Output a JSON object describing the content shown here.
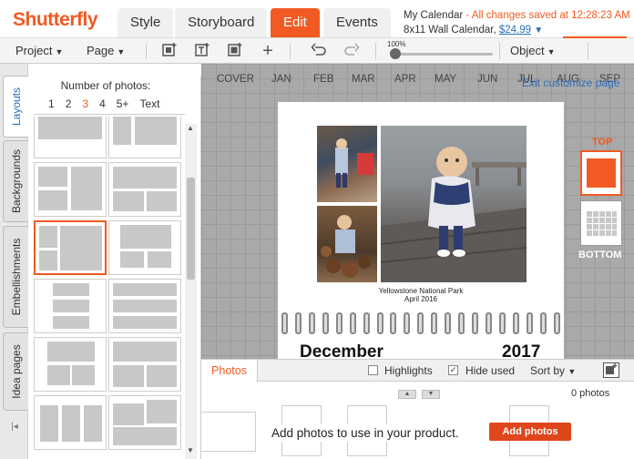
{
  "brand": {
    "logo": "Shutterfly",
    "accent": "#f15a22",
    "link": "#2a6ebb"
  },
  "tabs": [
    {
      "label": "Style",
      "active": false
    },
    {
      "label": "Storyboard",
      "active": false
    },
    {
      "label": "Edit",
      "active": true
    },
    {
      "label": "Events",
      "active": false
    }
  ],
  "calendar": {
    "name": "My Calendar",
    "separator": " - ",
    "saved": "All changes saved at 12:28:23 AM",
    "product": "8x11 Wall Calendar,",
    "price": "$24.99",
    "price_caret": "▼"
  },
  "toolbar": {
    "project": "Project",
    "page": "Page",
    "object": "Object",
    "zoom": "100%",
    "zoom_level": 0.0,
    "icons": [
      "add-page-icon",
      "add-text-icon",
      "add-photo-icon",
      "add-icon",
      "undo-icon",
      "redo-icon"
    ]
  },
  "side_tabs": [
    "Layouts",
    "Backgrounds",
    "Embellishments",
    "Idea pages"
  ],
  "layouts": {
    "title": "Number of photos:",
    "counts": [
      "1",
      "2",
      "3",
      "4",
      "5+",
      "Text"
    ],
    "selected_count": "3"
  },
  "months": [
    "COVER",
    "JAN",
    "FEB",
    "MAR",
    "APR",
    "MAY",
    "JUN",
    "JUL",
    "AUG",
    "SEP"
  ],
  "exit_link": "Exit customize page",
  "page": {
    "caption_line1": "Yellowstone National Park",
    "caption_line2": "April 2016",
    "month": "December",
    "year": "2017"
  },
  "side_buttons": {
    "top": "TOP",
    "bottom": "BOTTOM"
  },
  "photos_panel": {
    "tab": "Photos",
    "highlights": "Highlights",
    "hide_used": "Hide used",
    "sort_by": "Sort by",
    "count": "0 photos",
    "empty_message": "Add photos to use in your product.",
    "add_button": "Add photos"
  }
}
